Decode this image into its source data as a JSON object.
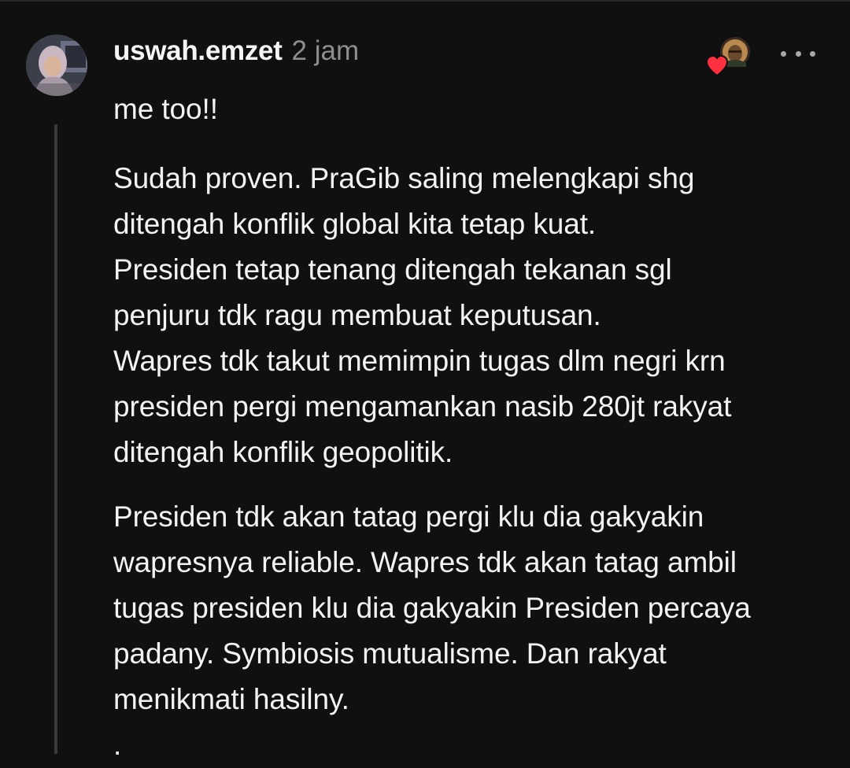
{
  "comment": {
    "username": "uswah.emzet",
    "time": "2 jam",
    "lines_intro": [
      "me too!!"
    ],
    "paragraph1": [
      "Sudah proven. PraGib saling melengkapi shg",
      "ditengah konflik global kita tetap kuat.",
      "Presiden tetap tenang ditengah tekanan sgl",
      "penjuru tdk ragu membuat keputusan.",
      "Wapres tdk takut memimpin tugas dlm negri krn",
      "presiden pergi mengamankan nasib 280jt rakyat",
      "ditengah konflik geopolitik."
    ],
    "paragraph2": [
      "Presiden tdk akan tatag pergi klu dia gakyakin",
      "wapresnya reliable. Wapres tdk akan tatag ambil",
      "tugas presiden klu dia gakyakin Presiden percaya",
      "padany. Symbiosis mutualisme. Dan rakyat",
      "menikmati hasilny."
    ],
    "trailing": "."
  },
  "icons": {
    "avatar": "user-avatar",
    "liked_by": "liked-by-author-avatar",
    "heart": "heart-icon",
    "more": "more-options-icon"
  },
  "colors": {
    "background": "#101010",
    "text": "#f3f3f3",
    "muted": "#8e8e8e",
    "heart": "#ff3040"
  }
}
